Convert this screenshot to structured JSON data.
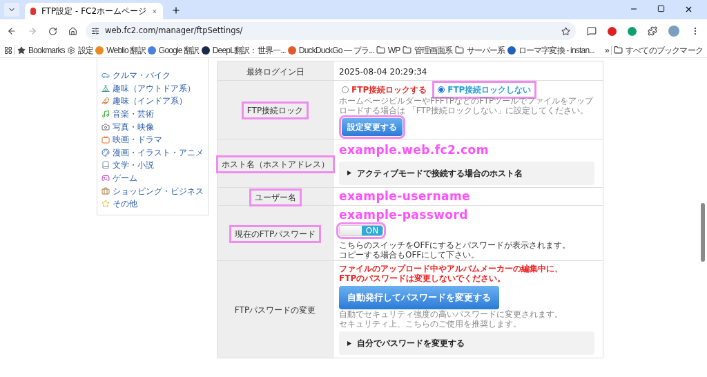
{
  "tab": {
    "title": "FTP設定 - FC2ホームページ",
    "selected": true
  },
  "address": "web.fc2.com/manager/ftpSettings/",
  "bookmarks": [
    {
      "label": "Bookmarks"
    },
    {
      "label": "設定"
    },
    {
      "label": "Weblio 翻訳"
    },
    {
      "label": "Google 翻訳"
    },
    {
      "label": "DeepL翻訳：世界一..."
    },
    {
      "label": "DuckDuckGo — プラ..."
    },
    {
      "label": "WP"
    },
    {
      "label": "管理画面系"
    },
    {
      "label": "サーバー系"
    },
    {
      "label": "ローマ字変換 - instan..."
    }
  ],
  "more_bookmarks": "»",
  "all_bookmarks": "すべてのブックマーク",
  "sidebar": {
    "items": [
      {
        "label": "クルマ・バイク"
      },
      {
        "label": "趣味（アウトドア系）"
      },
      {
        "label": "趣味（インドア系）"
      },
      {
        "label": "音楽・芸術"
      },
      {
        "label": "写真・映像"
      },
      {
        "label": "映画・ドラマ"
      },
      {
        "label": "漫画・イラスト・アニメ"
      },
      {
        "label": "文学・小説"
      },
      {
        "label": "ゲーム"
      },
      {
        "label": "ショッピング・ビジネス"
      },
      {
        "label": "その他"
      }
    ]
  },
  "settings": {
    "last_login": {
      "label": "最終ログイン日",
      "value": "2025-08-04 20:29:34"
    },
    "ftp_lock": {
      "label": "FTP接続ロック",
      "highlighted": true,
      "options": [
        {
          "label": "FTP接続ロックする",
          "selected": false,
          "color": "#e0302a"
        },
        {
          "label": "FTP接続ロックしない",
          "selected": true,
          "color": "#2a9fd6",
          "highlighted": true
        }
      ],
      "note": "ホームページビルダーやFFFTPなどのFTPツールでファイルをアップロードする場合は 「FTP接続ロックしない」に設定してください。",
      "button": {
        "label": "設定変更する",
        "highlighted": true
      }
    },
    "host": {
      "label": "ホスト名（ホストアドレス）",
      "highlighted": true,
      "value": "example.web.fc2.com",
      "expander": "アクティブモードで接続する場合のホスト名"
    },
    "user": {
      "label": "ユーザー名",
      "highlighted": true,
      "value": "example-username"
    },
    "password": {
      "label": "現在のFTPパスワード",
      "highlighted": true,
      "value": "example-password",
      "toggle": {
        "on": true,
        "label": "ON",
        "highlighted": true
      },
      "note": [
        "こちらのスイッチをOFFにするとパスワードが表示されます。",
        "コピーする場合もOFFにして下さい。"
      ]
    },
    "change": {
      "label": "FTPパスワードの変更",
      "warning": [
        "ファイルのアップロード中やアルバムメーカーの編集中に、",
        "FTPのパスワードは変更しないでください。"
      ],
      "button": "自動発行してパスワードを変更する",
      "note": [
        "自動でセキュリティ強度の高いパスワードに変更されます。",
        "セキュリティ上、こちらのご使用を推奨します。"
      ],
      "expander": "自分でパスワードを変更する"
    }
  }
}
